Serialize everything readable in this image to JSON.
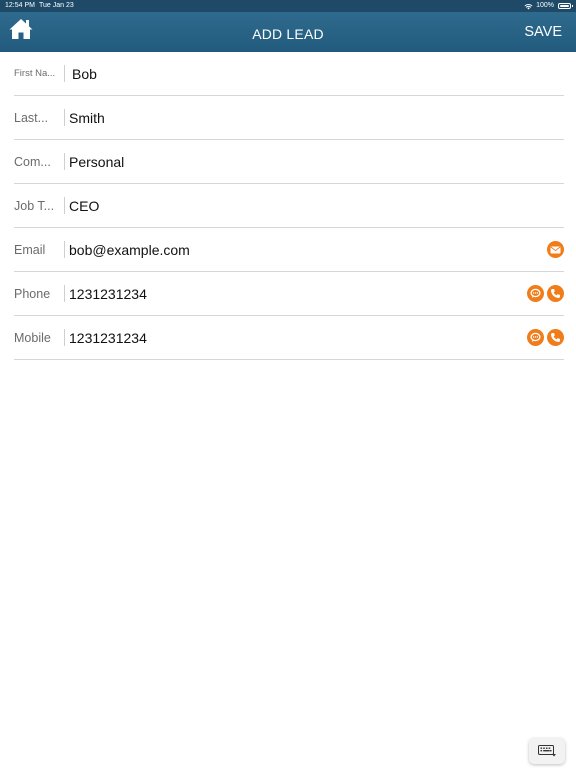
{
  "status_bar": {
    "time": "12:54 PM",
    "date": "Tue Jan 23",
    "battery": "100%"
  },
  "nav": {
    "title": "ADD LEAD",
    "save_label": "SAVE"
  },
  "fields": [
    {
      "label": "First Na...",
      "value": "Bob"
    },
    {
      "label": "Last...",
      "value": "Smith"
    },
    {
      "label": "Com...",
      "value": "Personal"
    },
    {
      "label": "Job T...",
      "value": "CEO"
    },
    {
      "label": "Email",
      "value": "bob@example.com"
    },
    {
      "label": "Phone",
      "value": "1231231234"
    },
    {
      "label": "Mobile",
      "value": "1231231234"
    }
  ],
  "colors": {
    "header": "#215a7d",
    "status_bar": "#1e4a68",
    "action_accent": "#f07d1a"
  },
  "icons": [
    "home-icon",
    "wifi-icon",
    "battery-icon",
    "mail-icon",
    "chat-icon",
    "phone-icon",
    "keyboard-icon"
  ]
}
